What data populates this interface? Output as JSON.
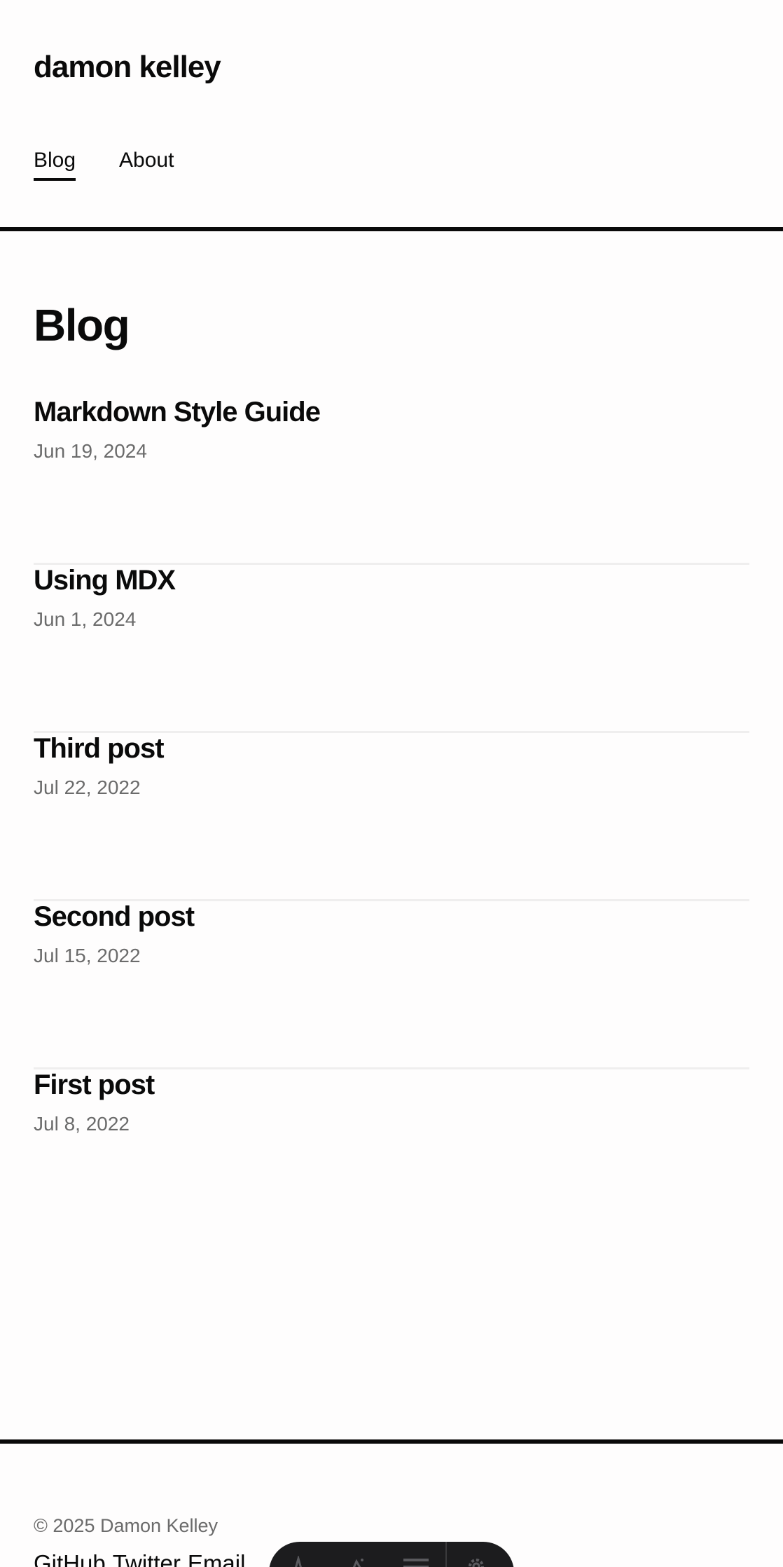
{
  "site": {
    "title": "damon kelley"
  },
  "nav": {
    "items": [
      {
        "label": "Blog"
      },
      {
        "label": "About"
      }
    ]
  },
  "main": {
    "heading": "Blog"
  },
  "posts": [
    {
      "title": "Markdown Style Guide",
      "date": "Jun 19, 2024"
    },
    {
      "title": "Using MDX",
      "date": "Jun 1, 2024"
    },
    {
      "title": "Third post",
      "date": "Jul 22, 2022"
    },
    {
      "title": "Second post",
      "date": "Jul 15, 2022"
    },
    {
      "title": "First post",
      "date": "Jul 8, 2022"
    }
  ],
  "footer": {
    "copyright": "© 2025 Damon Kelley",
    "links": [
      {
        "label": "GitHub"
      },
      {
        "label": "Twitter"
      },
      {
        "label": "Email"
      }
    ]
  },
  "toolbar": {
    "icons": [
      "astro-logo-icon",
      "audit-icon",
      "menu-icon",
      "settings-gear-icon"
    ]
  }
}
